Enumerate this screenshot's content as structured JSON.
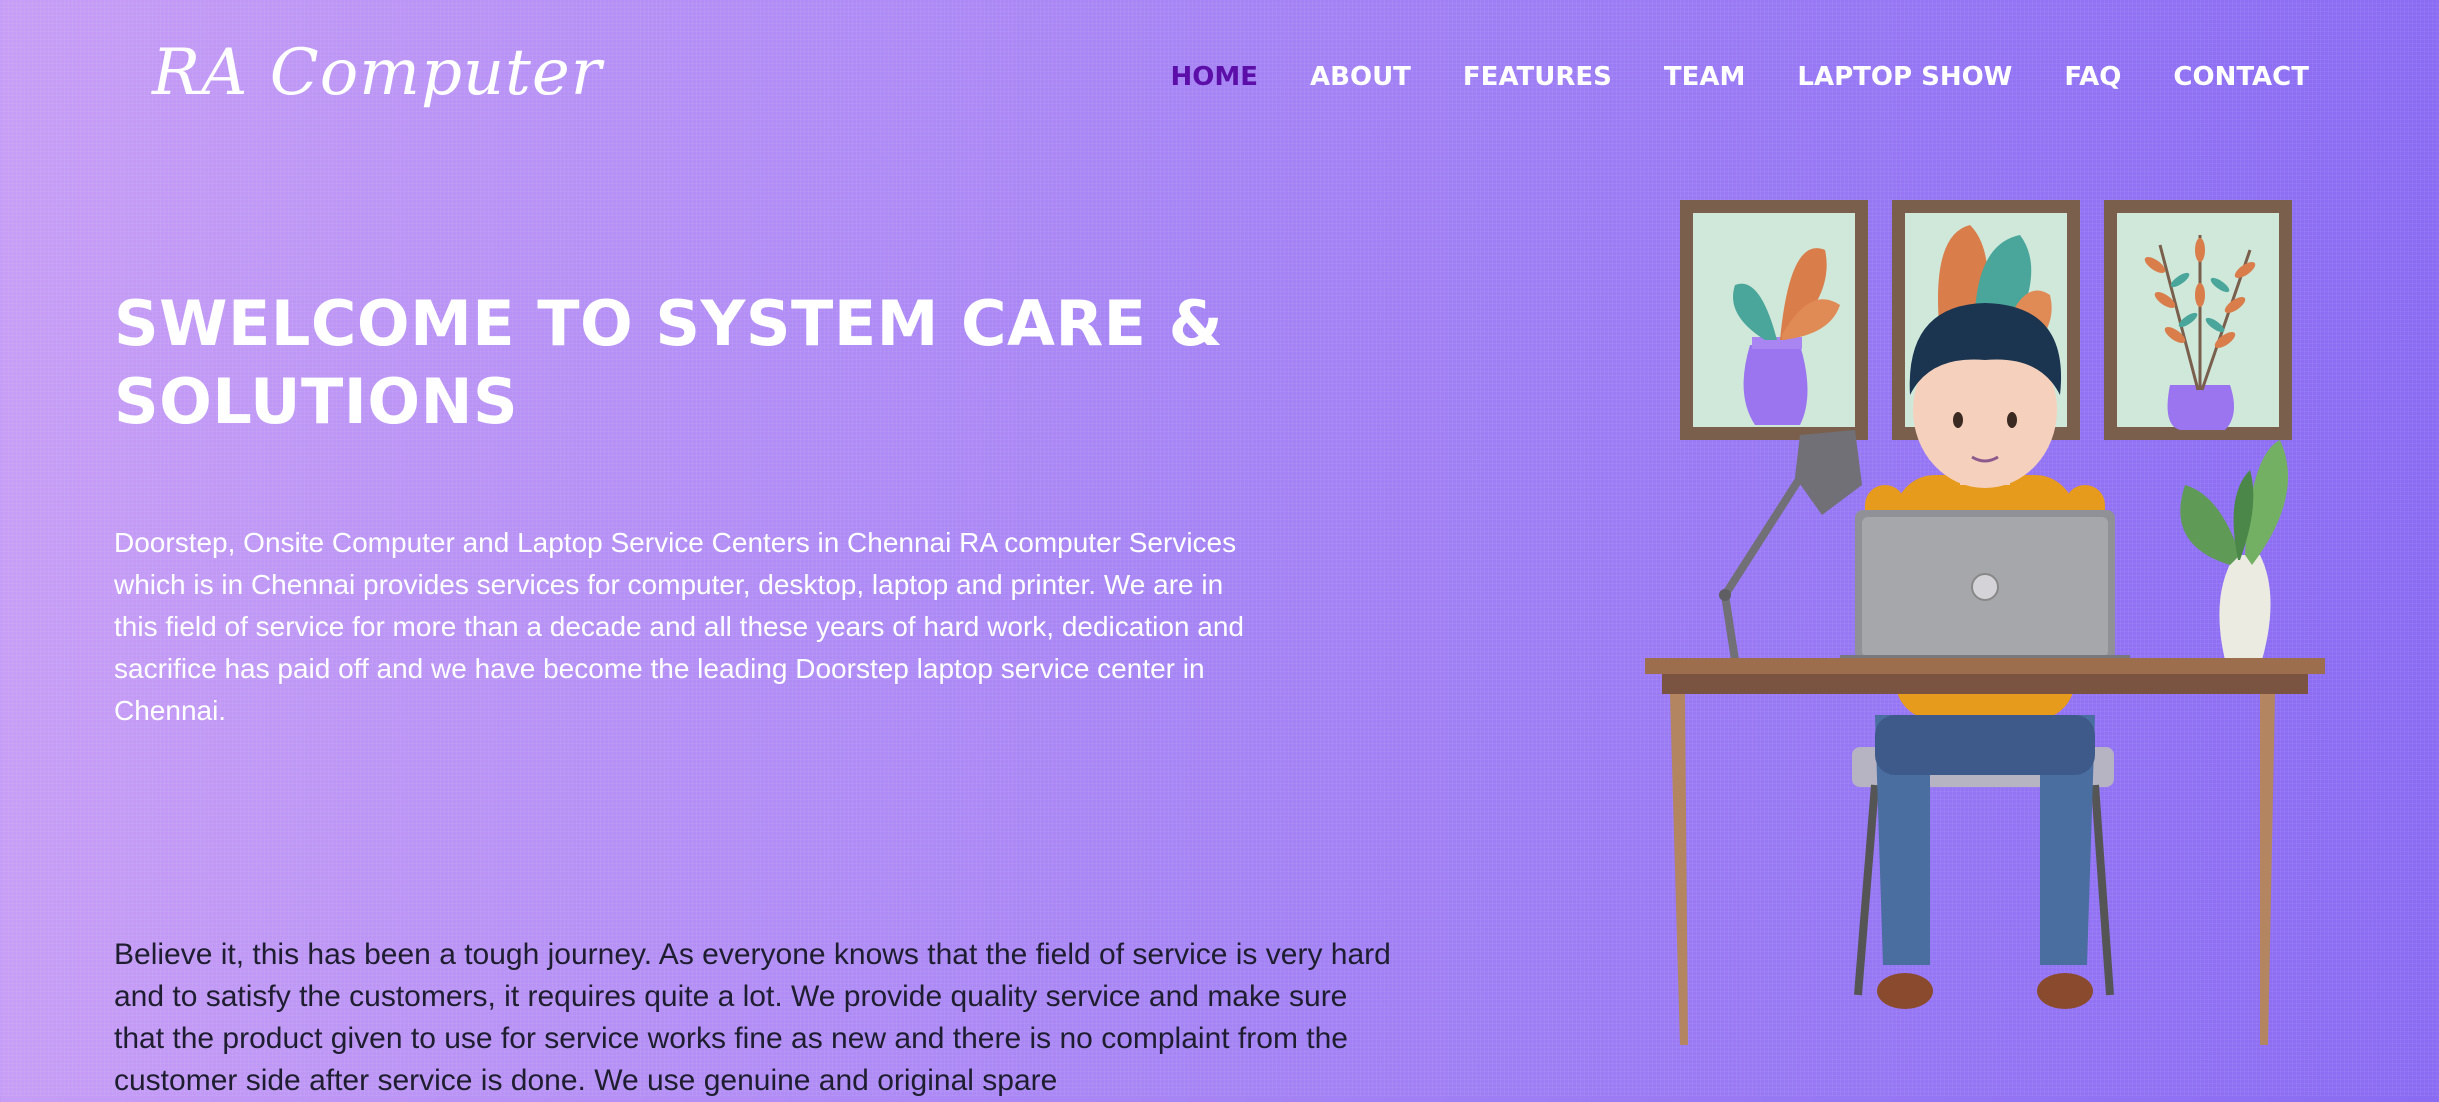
{
  "brand": {
    "logo_text": "RA Computer"
  },
  "nav": {
    "items": [
      {
        "label": "HOME",
        "active": true
      },
      {
        "label": "ABOUT",
        "active": false
      },
      {
        "label": "FEATURES",
        "active": false
      },
      {
        "label": "TEAM",
        "active": false
      },
      {
        "label": "LAPTOP SHOW",
        "active": false
      },
      {
        "label": "FAQ",
        "active": false
      },
      {
        "label": "CONTACT",
        "active": false
      }
    ],
    "active_color": "#5c0fa8"
  },
  "hero": {
    "title": "SWELCOME TO SYSTEM CARE & SOLUTIONS",
    "intro": "Doorstep, Onsite Computer and Laptop Service Centers in Chennai RA computer Services which is in Chennai provides services for computer, desktop, laptop and printer. We are in this field of service for more than a decade and all these years of hard work, dedication and sacrifice has paid off and we have become the leading Doorstep laptop service center in Chennai.",
    "journey": "Believe it, this has been a tough journey. As everyone knows that the field of service is very hard and to satisfy the customers, it requires quite a lot. We provide quality service and make sure that the product given to use for service works fine as new and there is no complaint from the customer side after service is done. We use genuine and original spare"
  },
  "illustration": {
    "subject": "person-working-on-laptop-illustration"
  },
  "colors": {
    "background_start": "#c79ef5",
    "background_end": "#8a6cf3",
    "text": "#ffffff"
  }
}
